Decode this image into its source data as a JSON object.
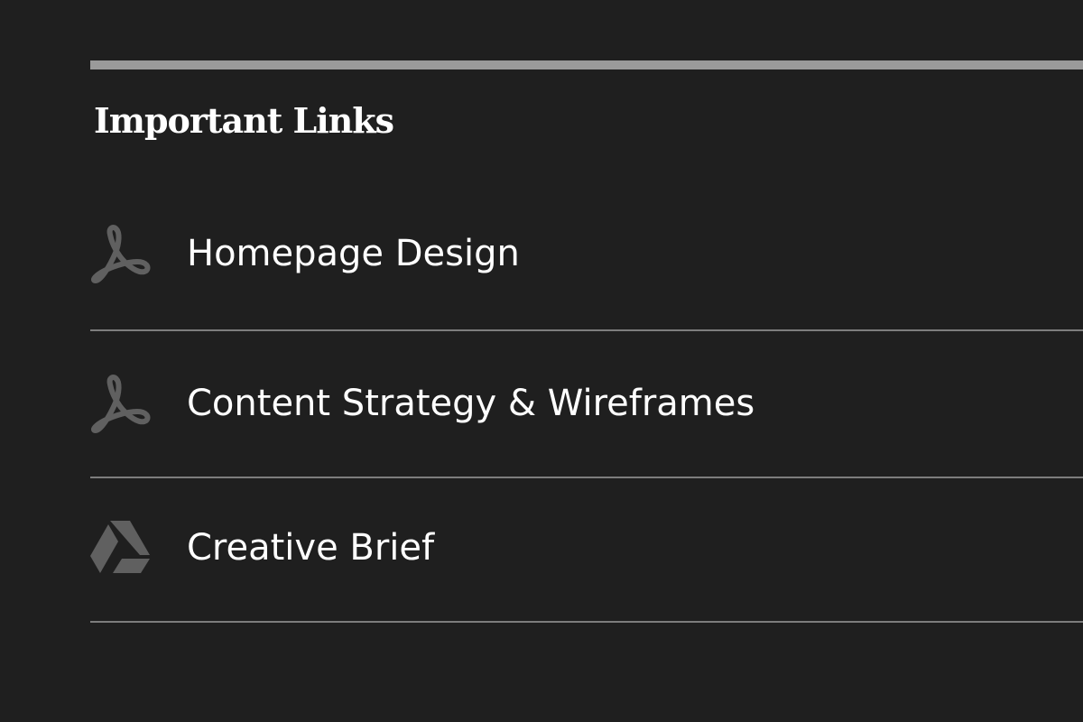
{
  "section": {
    "title": "Important Links"
  },
  "colors": {
    "background": "#1f1f1f",
    "rule": "#9a9a9a",
    "divider": "#7d7d7d",
    "icon": "#606060",
    "text": "#ffffff"
  },
  "links": [
    {
      "label": "Homepage Design",
      "icon": "pdf-icon"
    },
    {
      "label": "Content Strategy & Wireframes",
      "icon": "pdf-icon"
    },
    {
      "label": "Creative Brief",
      "icon": "google-drive-icon"
    }
  ]
}
